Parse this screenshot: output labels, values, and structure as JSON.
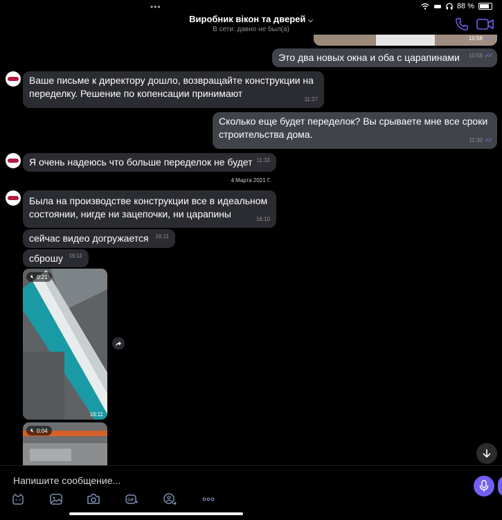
{
  "status": {
    "battery": "88 %"
  },
  "header": {
    "title": "Виробник вікон та дверей",
    "subtitle": "В сети: давно не был(а)"
  },
  "messages": [
    {
      "text": "Это два новых окна и оба с царапинами",
      "time": "10:59"
    },
    {
      "text": "Ваше письме к директору дошло, возвращайте конструкции на переделку. Решение по копенсации принимают",
      "time": "11:27"
    },
    {
      "text": "Сколько еще будет переделок? Вы срываете мне все сроки строительства дома.",
      "time": "11:30"
    },
    {
      "text": "Я очень надеюсь что больше переделок не будет",
      "time": "11:33"
    },
    {
      "text": "Была на производстве конструкции все в идеальном состоянии, нигде ни зацепочки, ни царапины",
      "time": "16:10"
    },
    {
      "text": "сейчас видео догружается",
      "time": "16:11"
    },
    {
      "text": "сброшу",
      "time": "16:11"
    }
  ],
  "top_image_time": "10:58",
  "date_separator": "4 Марта 2021 Г.",
  "videos": [
    {
      "duration": "0:21",
      "time": "16:11"
    },
    {
      "duration": "0:04"
    }
  ],
  "composer": {
    "placeholder": "Напишите сообщение..."
  },
  "colors": {
    "accent": "#7360f2",
    "incoming_bubble": "#2b2c31",
    "outgoing_bubble": "#41434a"
  }
}
